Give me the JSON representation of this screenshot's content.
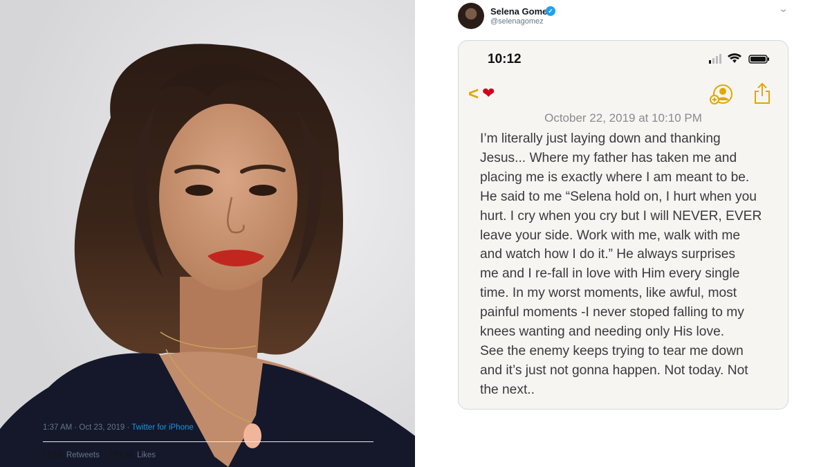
{
  "photo": {
    "alt_subject": "portrait"
  },
  "tweet": {
    "display_name": "Selena Gomez",
    "handle": "@selenagomez",
    "verified_icon": "verified-check-icon",
    "menu_icon": "chevron-down-icon",
    "note": {
      "status_time": "10:12",
      "back_icon": "chevron-left-icon",
      "heart": "❤",
      "date": "October 22, 2019 at 10:10 PM",
      "body": "I’m literally just laying down and thanking\nJesus... Where my father has taken me and\nplacing me is exactly where I am meant to be.\nHe said to me “Selena hold on, I hurt when you\nhurt. I cry when you cry but I will NEVER, EVER\nleave your side. Work with me, walk with me\nand watch how I do it.” He always surprises\nme and I re-fall in love with Him every single\ntime. In my worst moments, like awful, most\npainful moments -I never stoped falling to my\nknees wanting and needing only His love.\nSee the enemy keeps trying to tear me down\nand it’s just not gonna happen. Not today. Not\nthe next.."
    },
    "timestamp": "1:37 AM · Oct 23, 2019",
    "separator": " · ",
    "source": "Twitter for iPhone",
    "retweets_count": "37.9K",
    "retweets_label": "Retweets",
    "likes_count": "177.8K",
    "likes_label": "Likes"
  },
  "colors": {
    "accent_yellow": "#e0a800",
    "twitter_blue": "#1da1f2",
    "link_blue": "#1b95e0",
    "lip_red": "#c1271f"
  }
}
